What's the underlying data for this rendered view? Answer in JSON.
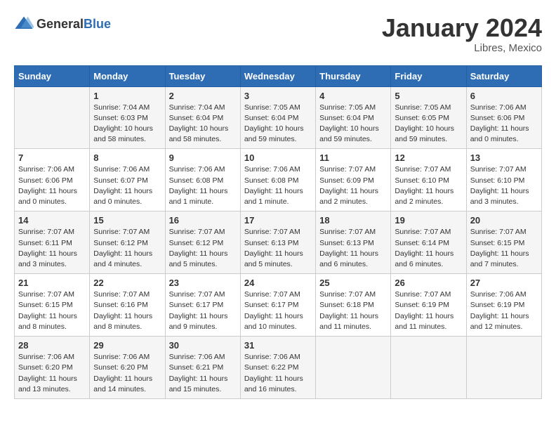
{
  "header": {
    "logo_general": "General",
    "logo_blue": "Blue",
    "month": "January 2024",
    "location": "Libres, Mexico"
  },
  "weekdays": [
    "Sunday",
    "Monday",
    "Tuesday",
    "Wednesday",
    "Thursday",
    "Friday",
    "Saturday"
  ],
  "weeks": [
    [
      {
        "day": "",
        "info": ""
      },
      {
        "day": "1",
        "info": "Sunrise: 7:04 AM\nSunset: 6:03 PM\nDaylight: 10 hours\nand 58 minutes."
      },
      {
        "day": "2",
        "info": "Sunrise: 7:04 AM\nSunset: 6:04 PM\nDaylight: 10 hours\nand 58 minutes."
      },
      {
        "day": "3",
        "info": "Sunrise: 7:05 AM\nSunset: 6:04 PM\nDaylight: 10 hours\nand 59 minutes."
      },
      {
        "day": "4",
        "info": "Sunrise: 7:05 AM\nSunset: 6:04 PM\nDaylight: 10 hours\nand 59 minutes."
      },
      {
        "day": "5",
        "info": "Sunrise: 7:05 AM\nSunset: 6:05 PM\nDaylight: 10 hours\nand 59 minutes."
      },
      {
        "day": "6",
        "info": "Sunrise: 7:06 AM\nSunset: 6:06 PM\nDaylight: 11 hours\nand 0 minutes."
      }
    ],
    [
      {
        "day": "7",
        "info": "Sunrise: 7:06 AM\nSunset: 6:06 PM\nDaylight: 11 hours\nand 0 minutes."
      },
      {
        "day": "8",
        "info": "Sunrise: 7:06 AM\nSunset: 6:07 PM\nDaylight: 11 hours\nand 0 minutes."
      },
      {
        "day": "9",
        "info": "Sunrise: 7:06 AM\nSunset: 6:08 PM\nDaylight: 11 hours\nand 1 minute."
      },
      {
        "day": "10",
        "info": "Sunrise: 7:06 AM\nSunset: 6:08 PM\nDaylight: 11 hours\nand 1 minute."
      },
      {
        "day": "11",
        "info": "Sunrise: 7:07 AM\nSunset: 6:09 PM\nDaylight: 11 hours\nand 2 minutes."
      },
      {
        "day": "12",
        "info": "Sunrise: 7:07 AM\nSunset: 6:10 PM\nDaylight: 11 hours\nand 2 minutes."
      },
      {
        "day": "13",
        "info": "Sunrise: 7:07 AM\nSunset: 6:10 PM\nDaylight: 11 hours\nand 3 minutes."
      }
    ],
    [
      {
        "day": "14",
        "info": "Sunrise: 7:07 AM\nSunset: 6:11 PM\nDaylight: 11 hours\nand 3 minutes."
      },
      {
        "day": "15",
        "info": "Sunrise: 7:07 AM\nSunset: 6:12 PM\nDaylight: 11 hours\nand 4 minutes."
      },
      {
        "day": "16",
        "info": "Sunrise: 7:07 AM\nSunset: 6:12 PM\nDaylight: 11 hours\nand 5 minutes."
      },
      {
        "day": "17",
        "info": "Sunrise: 7:07 AM\nSunset: 6:13 PM\nDaylight: 11 hours\nand 5 minutes."
      },
      {
        "day": "18",
        "info": "Sunrise: 7:07 AM\nSunset: 6:13 PM\nDaylight: 11 hours\nand 6 minutes."
      },
      {
        "day": "19",
        "info": "Sunrise: 7:07 AM\nSunset: 6:14 PM\nDaylight: 11 hours\nand 6 minutes."
      },
      {
        "day": "20",
        "info": "Sunrise: 7:07 AM\nSunset: 6:15 PM\nDaylight: 11 hours\nand 7 minutes."
      }
    ],
    [
      {
        "day": "21",
        "info": "Sunrise: 7:07 AM\nSunset: 6:15 PM\nDaylight: 11 hours\nand 8 minutes."
      },
      {
        "day": "22",
        "info": "Sunrise: 7:07 AM\nSunset: 6:16 PM\nDaylight: 11 hours\nand 8 minutes."
      },
      {
        "day": "23",
        "info": "Sunrise: 7:07 AM\nSunset: 6:17 PM\nDaylight: 11 hours\nand 9 minutes."
      },
      {
        "day": "24",
        "info": "Sunrise: 7:07 AM\nSunset: 6:17 PM\nDaylight: 11 hours\nand 10 minutes."
      },
      {
        "day": "25",
        "info": "Sunrise: 7:07 AM\nSunset: 6:18 PM\nDaylight: 11 hours\nand 11 minutes."
      },
      {
        "day": "26",
        "info": "Sunrise: 7:07 AM\nSunset: 6:19 PM\nDaylight: 11 hours\nand 11 minutes."
      },
      {
        "day": "27",
        "info": "Sunrise: 7:06 AM\nSunset: 6:19 PM\nDaylight: 11 hours\nand 12 minutes."
      }
    ],
    [
      {
        "day": "28",
        "info": "Sunrise: 7:06 AM\nSunset: 6:20 PM\nDaylight: 11 hours\nand 13 minutes."
      },
      {
        "day": "29",
        "info": "Sunrise: 7:06 AM\nSunset: 6:20 PM\nDaylight: 11 hours\nand 14 minutes."
      },
      {
        "day": "30",
        "info": "Sunrise: 7:06 AM\nSunset: 6:21 PM\nDaylight: 11 hours\nand 15 minutes."
      },
      {
        "day": "31",
        "info": "Sunrise: 7:06 AM\nSunset: 6:22 PM\nDaylight: 11 hours\nand 16 minutes."
      },
      {
        "day": "",
        "info": ""
      },
      {
        "day": "",
        "info": ""
      },
      {
        "day": "",
        "info": ""
      }
    ]
  ]
}
